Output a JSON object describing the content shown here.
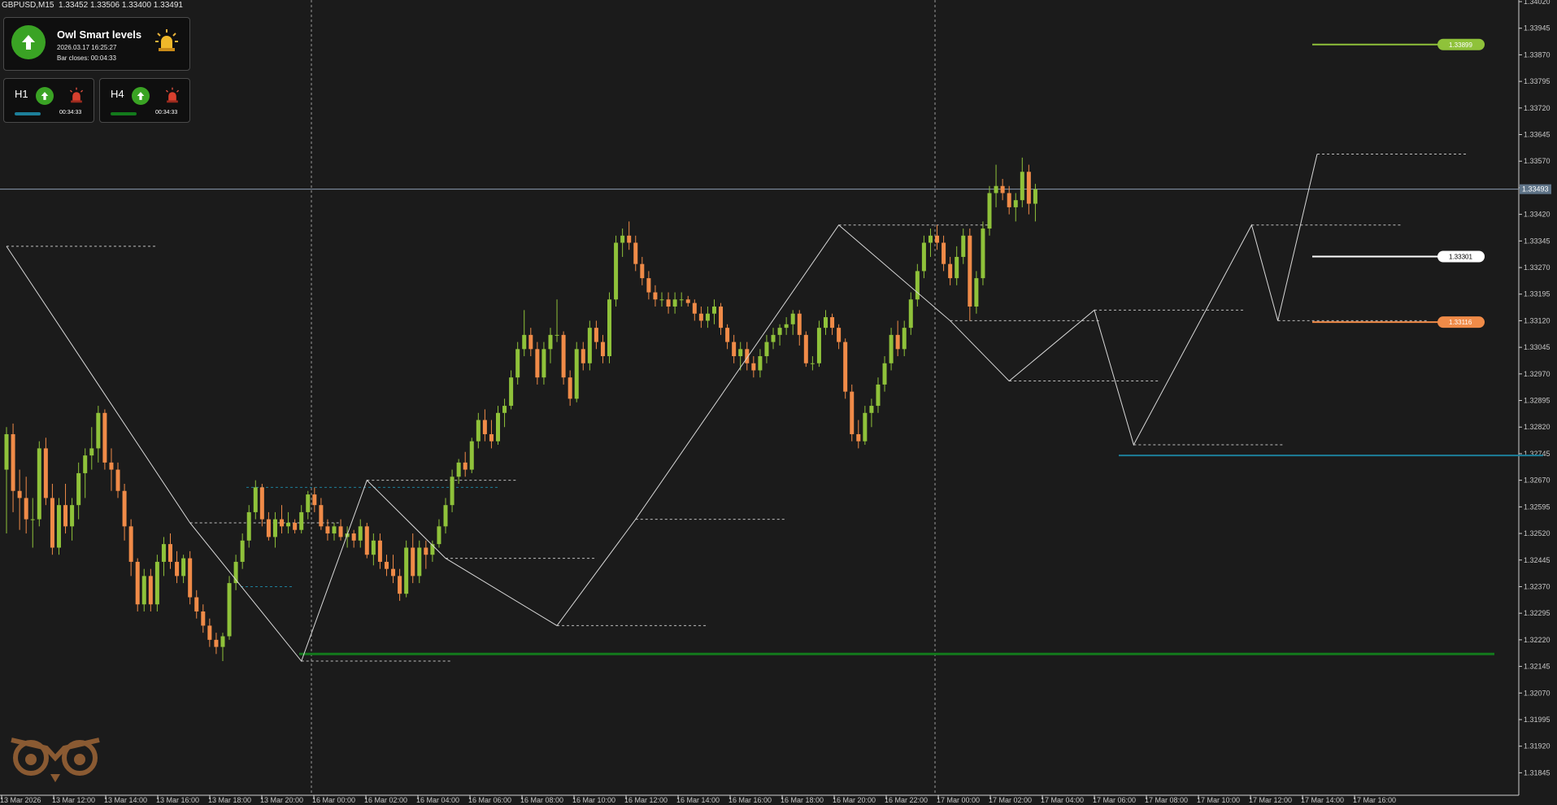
{
  "colors": {
    "background": "#1b1b1b",
    "bull_candle": "#8fc23a",
    "bear_candle": "#f08b48",
    "zigzag": "#d8d8d8",
    "level_dash": "#bdbdbd",
    "support_line": "#137a1c",
    "cyan_line": "#1d7f9a",
    "price_line": "#8a9bb0",
    "level_green": "#8fc23a",
    "level_white": "#ffffff",
    "level_orange": "#f08b48",
    "axis_text": "#c8c8c8"
  },
  "symbol_info": {
    "symbol": "GBPUSD,M15",
    "ohlc": "1.33452 1.33506 1.33400 1.33491"
  },
  "owl_panel": {
    "title": "Owl Smart levels",
    "datetime": "2026.03.17 16:25:27",
    "bar_closes": "Bar closes: 00:04:33",
    "direction_icon": "arrow-up-icon",
    "alert_icon": "siren-icon"
  },
  "timeframes": [
    {
      "label": "H1",
      "time": "00:34:33",
      "bar_color": "#1d7f9a",
      "direction_icon": "arrow-up-icon",
      "alert_icon": "siren-red-icon"
    },
    {
      "label": "H4",
      "time": "00:34:33",
      "bar_color": "#137a1c",
      "direction_icon": "arrow-up-icon",
      "alert_icon": "siren-red-icon"
    }
  ],
  "current_price_label": "1.33493",
  "chart_data": {
    "type": "candlestick",
    "ylim": [
      1.318,
      1.3402
    ],
    "price_ticks": [
      "1.34020",
      "1.33945",
      "1.33870",
      "1.33795",
      "1.33720",
      "1.33645",
      "1.33570",
      "1.33495",
      "1.33420",
      "1.33345",
      "1.33270",
      "1.33195",
      "1.33120",
      "1.33045",
      "1.32970",
      "1.32895",
      "1.32820",
      "1.32745",
      "1.32670",
      "1.32595",
      "1.32520",
      "1.32445",
      "1.32370",
      "1.32295",
      "1.32220",
      "1.32145",
      "1.32070",
      "1.31995",
      "1.31920",
      "1.31845"
    ],
    "time_labels": [
      "13 Mar 2026",
      "13 Mar 12:00",
      "13 Mar 14:00",
      "13 Mar 16:00",
      "13 Mar 18:00",
      "13 Mar 20:00",
      "16 Mar 00:00",
      "16 Mar 02:00",
      "16 Mar 04:00",
      "16 Mar 06:00",
      "16 Mar 08:00",
      "16 Mar 10:00",
      "16 Mar 12:00",
      "16 Mar 14:00",
      "16 Mar 16:00",
      "16 Mar 18:00",
      "16 Mar 20:00",
      "16 Mar 22:00",
      "17 Mar 00:00",
      "17 Mar 02:00",
      "17 Mar 04:00",
      "17 Mar 06:00",
      "17 Mar 08:00",
      "17 Mar 10:00",
      "17 Mar 12:00",
      "17 Mar 14:00",
      "17 Mar 16:00"
    ],
    "smart_levels": [
      {
        "name": "upper-target",
        "value": "1.33899",
        "color": "#8fc23a"
      },
      {
        "name": "pivot",
        "value": "1.33301",
        "color": "#ffffff"
      },
      {
        "name": "lower-target",
        "value": "1.33116",
        "color": "#f08b48"
      }
    ],
    "zigzag_points": [
      [
        0,
        1.3333
      ],
      [
        28,
        1.3255
      ],
      [
        45,
        1.3216
      ],
      [
        55,
        1.3267
      ],
      [
        67,
        1.3245
      ],
      [
        84,
        1.3226
      ],
      [
        96,
        1.3256
      ],
      [
        127,
        1.3339
      ],
      [
        144,
        1.3312
      ],
      [
        153,
        1.3295
      ],
      [
        166,
        1.3315
      ],
      [
        172,
        1.3277
      ],
      [
        190,
        1.3339
      ],
      [
        194,
        1.3312
      ],
      [
        200,
        1.3359
      ]
    ],
    "candles": [
      [
        1.327,
        1.3282,
        1.3252,
        1.328
      ],
      [
        1.328,
        1.3283,
        1.3258,
        1.3264
      ],
      [
        1.3264,
        1.327,
        1.3253,
        1.3262
      ],
      [
        1.3262,
        1.3268,
        1.3252,
        1.3256
      ],
      [
        1.3256,
        1.3262,
        1.3248,
        1.3256
      ],
      [
        1.3256,
        1.3278,
        1.3254,
        1.3276
      ],
      [
        1.3276,
        1.3279,
        1.326,
        1.3262
      ],
      [
        1.3262,
        1.3266,
        1.3246,
        1.3248
      ],
      [
        1.3248,
        1.3262,
        1.3246,
        1.326
      ],
      [
        1.326,
        1.3266,
        1.3252,
        1.3254
      ],
      [
        1.3254,
        1.3262,
        1.325,
        1.326
      ],
      [
        1.326,
        1.3272,
        1.3256,
        1.3269
      ],
      [
        1.3269,
        1.3276,
        1.3262,
        1.3274
      ],
      [
        1.3274,
        1.3282,
        1.327,
        1.3276
      ],
      [
        1.3276,
        1.3288,
        1.3272,
        1.3286
      ],
      [
        1.3286,
        1.3287,
        1.327,
        1.3272
      ],
      [
        1.3272,
        1.3276,
        1.3264,
        1.327
      ],
      [
        1.327,
        1.3272,
        1.3262,
        1.3264
      ],
      [
        1.3264,
        1.3266,
        1.325,
        1.3254
      ],
      [
        1.3254,
        1.3256,
        1.324,
        1.3244
      ],
      [
        1.3244,
        1.3245,
        1.323,
        1.3232
      ],
      [
        1.3232,
        1.3242,
        1.323,
        1.324
      ],
      [
        1.324,
        1.3242,
        1.323,
        1.3232
      ],
      [
        1.3232,
        1.3246,
        1.323,
        1.3244
      ],
      [
        1.3244,
        1.3251,
        1.324,
        1.3249
      ],
      [
        1.3249,
        1.3252,
        1.3242,
        1.3244
      ],
      [
        1.3244,
        1.3247,
        1.3238,
        1.324
      ],
      [
        1.324,
        1.3246,
        1.3238,
        1.3245
      ],
      [
        1.3245,
        1.3247,
        1.3232,
        1.3234
      ],
      [
        1.3234,
        1.3236,
        1.3228,
        1.323
      ],
      [
        1.323,
        1.3232,
        1.3224,
        1.3226
      ],
      [
        1.3226,
        1.3228,
        1.322,
        1.3222
      ],
      [
        1.3222,
        1.3224,
        1.3218,
        1.322
      ],
      [
        1.322,
        1.3224,
        1.3216,
        1.3223
      ],
      [
        1.3223,
        1.324,
        1.3222,
        1.3238
      ],
      [
        1.3238,
        1.3246,
        1.3236,
        1.3244
      ],
      [
        1.3244,
        1.3252,
        1.3242,
        1.325
      ],
      [
        1.325,
        1.326,
        1.3248,
        1.3258
      ],
      [
        1.3258,
        1.3267,
        1.3256,
        1.3265
      ],
      [
        1.3265,
        1.3266,
        1.3254,
        1.3256
      ],
      [
        1.3256,
        1.3258,
        1.325,
        1.3251
      ],
      [
        1.3251,
        1.3258,
        1.3248,
        1.3256
      ],
      [
        1.3256,
        1.326,
        1.3252,
        1.3254
      ],
      [
        1.3254,
        1.3258,
        1.3252,
        1.3255
      ],
      [
        1.3255,
        1.3256,
        1.3252,
        1.3253
      ],
      [
        1.3253,
        1.326,
        1.3252,
        1.3258
      ],
      [
        1.3258,
        1.3264,
        1.3256,
        1.3263
      ],
      [
        1.3263,
        1.3265,
        1.3258,
        1.326
      ],
      [
        1.326,
        1.3262,
        1.3253,
        1.3254
      ],
      [
        1.3254,
        1.3256,
        1.325,
        1.3252
      ],
      [
        1.3252,
        1.3255,
        1.325,
        1.3254
      ],
      [
        1.3254,
        1.3256,
        1.325,
        1.3251
      ],
      [
        1.3251,
        1.3254,
        1.3248,
        1.3252
      ],
      [
        1.3252,
        1.3253,
        1.3248,
        1.325
      ],
      [
        1.325,
        1.3256,
        1.3248,
        1.3254
      ],
      [
        1.3254,
        1.3255,
        1.3245,
        1.3246
      ],
      [
        1.3246,
        1.3252,
        1.3243,
        1.325
      ],
      [
        1.325,
        1.3252,
        1.3242,
        1.3244
      ],
      [
        1.3244,
        1.3246,
        1.324,
        1.3242
      ],
      [
        1.3242,
        1.3246,
        1.3238,
        1.324
      ],
      [
        1.324,
        1.3242,
        1.3233,
        1.3235
      ],
      [
        1.3235,
        1.325,
        1.3234,
        1.3248
      ],
      [
        1.3248,
        1.3252,
        1.3238,
        1.324
      ],
      [
        1.324,
        1.325,
        1.3238,
        1.3248
      ],
      [
        1.3248,
        1.325,
        1.3242,
        1.3246
      ],
      [
        1.3246,
        1.325,
        1.3244,
        1.3249
      ],
      [
        1.3249,
        1.3256,
        1.3248,
        1.3254
      ],
      [
        1.3254,
        1.3262,
        1.3252,
        1.326
      ],
      [
        1.326,
        1.327,
        1.3258,
        1.3268
      ],
      [
        1.3268,
        1.3273,
        1.3266,
        1.3272
      ],
      [
        1.3272,
        1.3275,
        1.3268,
        1.327
      ],
      [
        1.327,
        1.3279,
        1.3269,
        1.3278
      ],
      [
        1.3278,
        1.3286,
        1.3276,
        1.3284
      ],
      [
        1.3284,
        1.3287,
        1.3278,
        1.328
      ],
      [
        1.328,
        1.3284,
        1.3276,
        1.3278
      ],
      [
        1.3278,
        1.3288,
        1.3277,
        1.3286
      ],
      [
        1.3286,
        1.329,
        1.3282,
        1.3288
      ],
      [
        1.3288,
        1.3298,
        1.3287,
        1.3296
      ],
      [
        1.3296,
        1.3306,
        1.3294,
        1.3304
      ],
      [
        1.3304,
        1.3315,
        1.3302,
        1.3308
      ],
      [
        1.3308,
        1.331,
        1.3302,
        1.3304
      ],
      [
        1.3304,
        1.3306,
        1.3294,
        1.3296
      ],
      [
        1.3296,
        1.3306,
        1.3294,
        1.3304
      ],
      [
        1.3304,
        1.331,
        1.33,
        1.3308
      ],
      [
        1.3308,
        1.3318,
        1.3306,
        1.3308
      ],
      [
        1.3308,
        1.3309,
        1.3294,
        1.3296
      ],
      [
        1.3296,
        1.3298,
        1.3288,
        1.329
      ],
      [
        1.329,
        1.3306,
        1.3289,
        1.3304
      ],
      [
        1.3304,
        1.3306,
        1.3298,
        1.33
      ],
      [
        1.33,
        1.3312,
        1.3298,
        1.331
      ],
      [
        1.331,
        1.3312,
        1.3304,
        1.3306
      ],
      [
        1.3306,
        1.3308,
        1.33,
        1.3302
      ],
      [
        1.3302,
        1.332,
        1.33,
        1.3318
      ],
      [
        1.3318,
        1.3336,
        1.3316,
        1.3334
      ],
      [
        1.3334,
        1.3338,
        1.333,
        1.3336
      ],
      [
        1.3336,
        1.334,
        1.3332,
        1.3334
      ],
      [
        1.3334,
        1.3336,
        1.3326,
        1.3328
      ],
      [
        1.3328,
        1.333,
        1.3322,
        1.3324
      ],
      [
        1.3324,
        1.3326,
        1.3318,
        1.332
      ],
      [
        1.332,
        1.3322,
        1.3316,
        1.3318
      ],
      [
        1.3318,
        1.332,
        1.3316,
        1.3318
      ],
      [
        1.3318,
        1.332,
        1.3314,
        1.3316
      ],
      [
        1.3316,
        1.332,
        1.3314,
        1.3318
      ],
      [
        1.3318,
        1.332,
        1.3316,
        1.3318
      ],
      [
        1.3318,
        1.3319,
        1.3316,
        1.3317
      ],
      [
        1.3317,
        1.3318,
        1.3312,
        1.3314
      ],
      [
        1.3314,
        1.3316,
        1.331,
        1.3312
      ],
      [
        1.3312,
        1.3316,
        1.331,
        1.3314
      ],
      [
        1.3314,
        1.3318,
        1.3311,
        1.3316
      ],
      [
        1.3316,
        1.3317,
        1.3308,
        1.331
      ],
      [
        1.331,
        1.3311,
        1.3304,
        1.3306
      ],
      [
        1.3306,
        1.3308,
        1.33,
        1.3302
      ],
      [
        1.3302,
        1.3306,
        1.3298,
        1.3304
      ],
      [
        1.3304,
        1.3306,
        1.3298,
        1.33
      ],
      [
        1.33,
        1.3302,
        1.3296,
        1.3298
      ],
      [
        1.3298,
        1.3304,
        1.3296,
        1.3302
      ],
      [
        1.3302,
        1.3308,
        1.33,
        1.3306
      ],
      [
        1.3306,
        1.331,
        1.3304,
        1.3308
      ],
      [
        1.3308,
        1.3311,
        1.3305,
        1.331
      ],
      [
        1.331,
        1.3313,
        1.3308,
        1.3311
      ],
      [
        1.3311,
        1.3315,
        1.3308,
        1.3314
      ],
      [
        1.3314,
        1.3315,
        1.3305,
        1.3308
      ],
      [
        1.3308,
        1.3309,
        1.3299,
        1.33
      ],
      [
        1.33,
        1.3302,
        1.3298,
        1.33
      ],
      [
        1.33,
        1.3312,
        1.3299,
        1.331
      ],
      [
        1.331,
        1.3315,
        1.3308,
        1.3313
      ],
      [
        1.3313,
        1.3314,
        1.3308,
        1.331
      ],
      [
        1.331,
        1.3311,
        1.3304,
        1.3306
      ],
      [
        1.3306,
        1.3307,
        1.329,
        1.3292
      ],
      [
        1.3292,
        1.3294,
        1.3278,
        1.328
      ],
      [
        1.328,
        1.3284,
        1.3276,
        1.3278
      ],
      [
        1.3278,
        1.3288,
        1.3277,
        1.3286
      ],
      [
        1.3286,
        1.329,
        1.3282,
        1.3288
      ],
      [
        1.3288,
        1.3296,
        1.3286,
        1.3294
      ],
      [
        1.3294,
        1.3302,
        1.3292,
        1.33
      ],
      [
        1.33,
        1.331,
        1.3298,
        1.3308
      ],
      [
        1.3308,
        1.3312,
        1.3302,
        1.3304
      ],
      [
        1.3304,
        1.3312,
        1.3302,
        1.331
      ],
      [
        1.331,
        1.332,
        1.3308,
        1.3318
      ],
      [
        1.3318,
        1.3328,
        1.3316,
        1.3326
      ],
      [
        1.3326,
        1.3336,
        1.3324,
        1.3334
      ],
      [
        1.3334,
        1.3338,
        1.333,
        1.3336
      ],
      [
        1.3336,
        1.3339,
        1.3332,
        1.3334
      ],
      [
        1.3334,
        1.3336,
        1.3326,
        1.3328
      ],
      [
        1.3328,
        1.333,
        1.3322,
        1.3324
      ],
      [
        1.3324,
        1.3333,
        1.3322,
        1.333
      ],
      [
        1.333,
        1.3338,
        1.3328,
        1.3336
      ],
      [
        1.3336,
        1.3338,
        1.3312,
        1.3316
      ],
      [
        1.3316,
        1.3326,
        1.3314,
        1.3324
      ],
      [
        1.3324,
        1.334,
        1.3322,
        1.3338
      ],
      [
        1.3338,
        1.335,
        1.3336,
        1.3348
      ],
      [
        1.3348,
        1.3356,
        1.3344,
        1.335
      ],
      [
        1.335,
        1.3352,
        1.3346,
        1.3348
      ],
      [
        1.3348,
        1.335,
        1.3342,
        1.3344
      ],
      [
        1.3344,
        1.3348,
        1.334,
        1.3346
      ],
      [
        1.3346,
        1.3358,
        1.3344,
        1.3354
      ],
      [
        1.3354,
        1.3356,
        1.3342,
        1.3345
      ],
      [
        1.3345,
        1.33506,
        1.334,
        1.33491
      ]
    ]
  }
}
